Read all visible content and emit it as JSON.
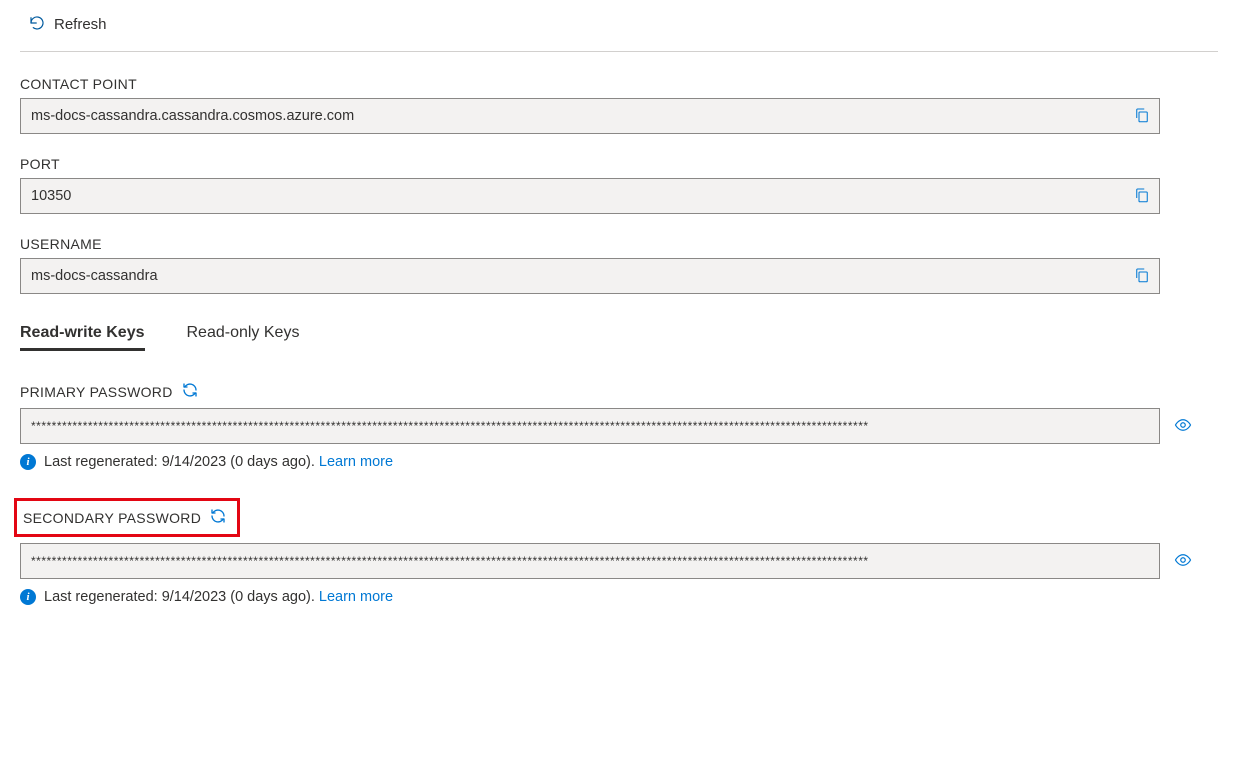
{
  "toolbar": {
    "refresh_label": "Refresh"
  },
  "fields": {
    "contact_point": {
      "label": "CONTACT POINT",
      "value": "ms-docs-cassandra.cassandra.cosmos.azure.com"
    },
    "port": {
      "label": "PORT",
      "value": "10350"
    },
    "username": {
      "label": "USERNAME",
      "value": "ms-docs-cassandra"
    }
  },
  "tabs": {
    "read_write": "Read-write Keys",
    "read_only": "Read-only Keys"
  },
  "primary": {
    "label": "PRIMARY PASSWORD",
    "masked": "******************************************************************************************************************************************************************",
    "regen_prefix": "Last regenerated: ",
    "regen_date": "9/14/2023 (0 days ago). ",
    "learn_more": "Learn more"
  },
  "secondary": {
    "label": "SECONDARY PASSWORD",
    "masked": "******************************************************************************************************************************************************************",
    "regen_prefix": "Last regenerated: ",
    "regen_date": "9/14/2023 (0 days ago). ",
    "learn_more": "Learn more"
  },
  "info_glyph": "i"
}
